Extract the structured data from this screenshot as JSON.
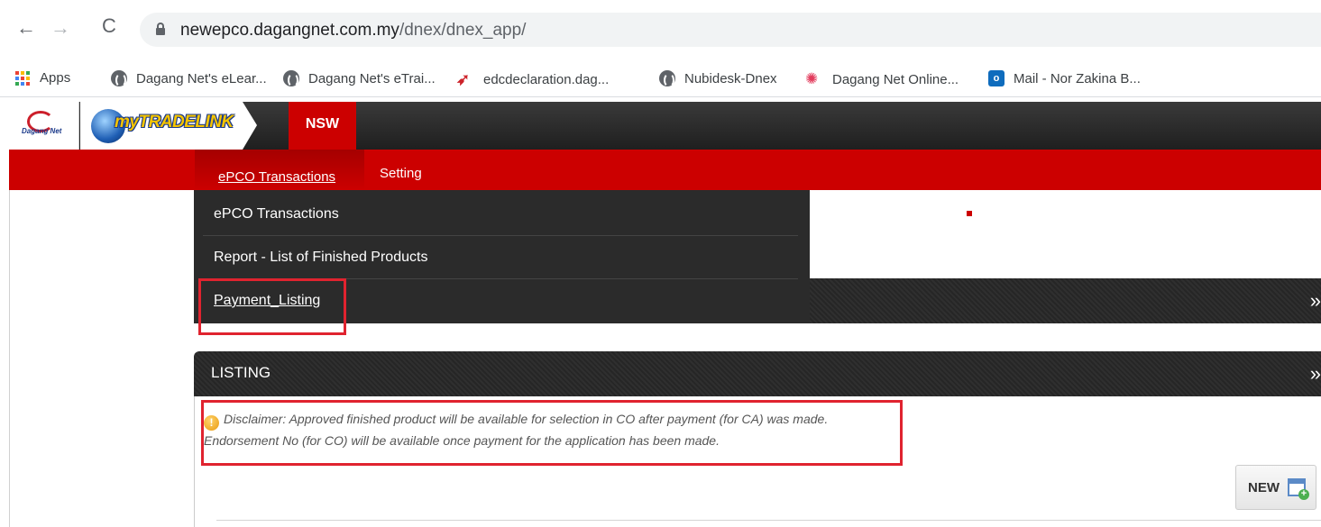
{
  "browser": {
    "url_host": "newepco.dagangnet.com.my",
    "url_path": "/dnex/dnex_app/",
    "nav": {
      "back": "←",
      "forward": "→",
      "reload": "C"
    },
    "bookmarks": [
      {
        "label": "Apps",
        "icon": "apps-grid-icon"
      },
      {
        "label": "Dagang Net's eLear...",
        "icon": "globe-icon"
      },
      {
        "label": "Dagang Net's eTrai...",
        "icon": "globe-icon"
      },
      {
        "label": "edcdeclaration.dag...",
        "icon": "edc-icon"
      },
      {
        "label": "Nubidesk-Dnex",
        "icon": "globe-icon"
      },
      {
        "label": "Dagang Net Online...",
        "icon": "pinwheel-icon"
      },
      {
        "label": "Mail - Nor Zakina B...",
        "icon": "outlook-icon"
      }
    ],
    "apps_grid_colors": [
      "#ea4335",
      "#fbbc04",
      "#34a853",
      "#4285f4",
      "#ea4335",
      "#fbbc04",
      "#34a853",
      "#4285f4",
      "#ea4335"
    ]
  },
  "app": {
    "logo_main": "myTRADELINK",
    "logo_sub": "Dagang Net",
    "top_tab": "NSW",
    "menu": {
      "active": "ePCO Transactions",
      "setting": "Setting"
    },
    "dropdown": [
      {
        "label": "ePCO Transactions"
      },
      {
        "label": "Report - List of Finished Products"
      },
      {
        "label": "Payment_Listing"
      }
    ],
    "listing": {
      "title": "LISTING",
      "disclaimer_line1": "Disclaimer: Approved finished product will be available for selection in CO after payment (for CA) was made.",
      "disclaimer_line2": "Endorsement No (for CO) will be available once payment for the application has been made.",
      "new_button": "NEW"
    },
    "colors": {
      "brand_red": "#cc0000",
      "highlight_red": "#e0232f",
      "dark_panel": "#2b2b2b"
    }
  }
}
